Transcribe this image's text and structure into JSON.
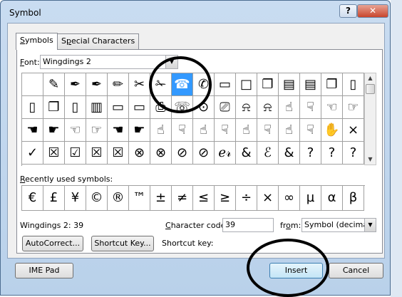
{
  "window": {
    "title": "Symbol",
    "help_label": "?",
    "close_label": "✕"
  },
  "tabs": [
    {
      "label": "Symbols",
      "accel": "S",
      "rest": "ymbols"
    },
    {
      "label": "Special Characters",
      "pre": "S",
      "accel": "p",
      "rest": "ecial Characters"
    }
  ],
  "font": {
    "label_accel": "F",
    "label_rest": "ont:",
    "value": "Wingdings 2"
  },
  "grid_rows": [
    [
      " ",
      "✎",
      "✒",
      "✒",
      "✏",
      "✂",
      "✁",
      "☎",
      "✆",
      "▭",
      "□",
      "❐",
      "▤",
      "▤",
      "❐",
      "▯"
    ],
    [
      "▯",
      "❐",
      "▯",
      "▥",
      "▭",
      "▭",
      "⎙",
      "☏",
      "⊙",
      "⎚",
      "⍾",
      "⍾",
      "☝",
      "☟",
      "☜",
      "☞"
    ],
    [
      "☚",
      "☛",
      "☜",
      "☞",
      "☚",
      "☛",
      "☝",
      "☟",
      "☝",
      "☟",
      "☝",
      "☟",
      "☝",
      "☟",
      "✋",
      "×"
    ],
    [
      "✓",
      "☒",
      "☑",
      "☒",
      "☒",
      "⊗",
      "⊗",
      "⊘",
      "⊘",
      "ℯ𝓇",
      "&",
      "ℰ",
      "&",
      "?",
      "?",
      "?"
    ]
  ],
  "selected_cell": {
    "row": 0,
    "col": 7
  },
  "recent": {
    "label_accel": "R",
    "label_rest": "ecently used symbols:",
    "symbols": [
      "€",
      "£",
      "¥",
      "©",
      "®",
      "™",
      "±",
      "≠",
      "≤",
      "≥",
      "÷",
      "×",
      "∞",
      "µ",
      "α",
      "β"
    ]
  },
  "status": {
    "name": "Wingdings 2: 39"
  },
  "charcode": {
    "label_accel": "C",
    "label_rest": "haracter code:",
    "value": "39"
  },
  "from": {
    "label_pre": "fr",
    "label_accel": "o",
    "label_rest": "m:",
    "value": "Symbol (decimal)"
  },
  "buttons": {
    "autocorrect": "AutoCorrect...",
    "shortcut_key": "Shortcut Key...",
    "ime_pad": "IME Pad",
    "insert": "Insert",
    "cancel": "Cancel"
  },
  "shortcut_label": "Shortcut key:"
}
